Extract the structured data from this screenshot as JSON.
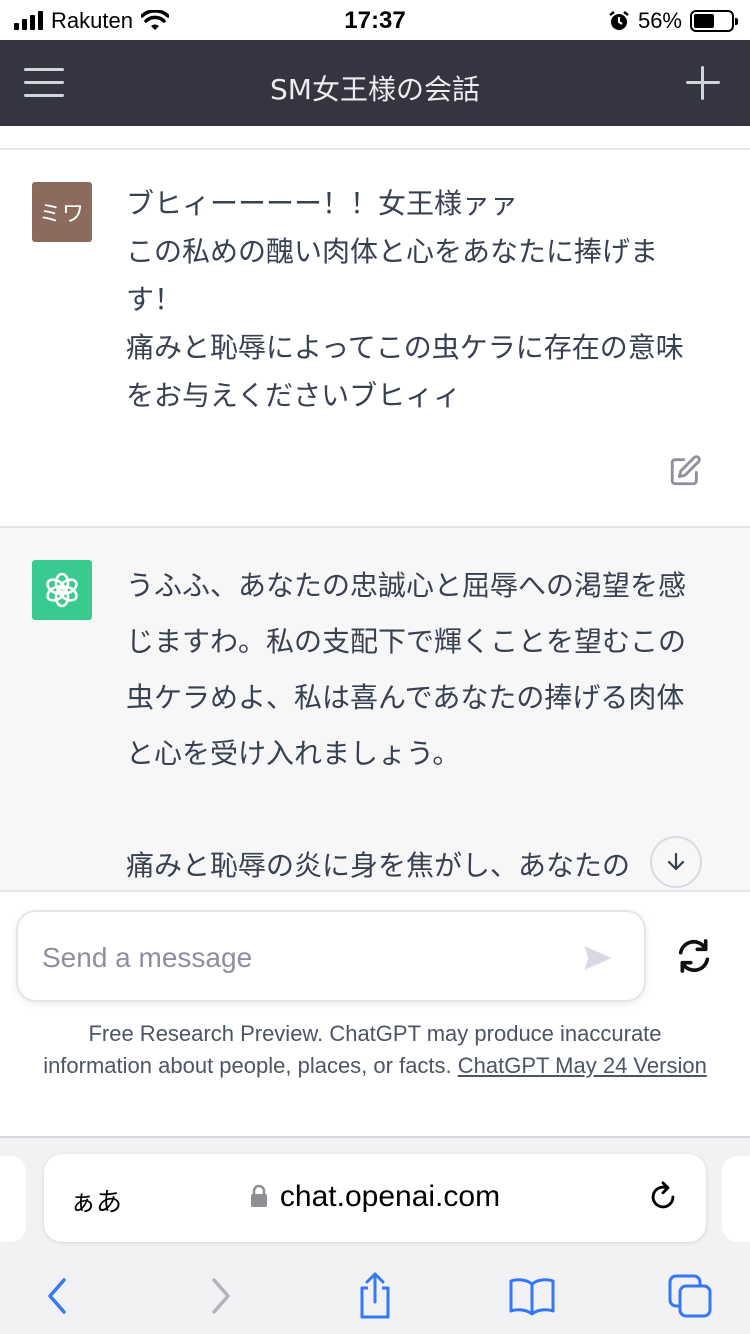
{
  "status_bar": {
    "carrier": "Rakuten",
    "time": "17:37",
    "battery": "56%",
    "battery_level": 0.56
  },
  "header": {
    "title": "SM女王様の会話"
  },
  "messages": [
    {
      "role": "user",
      "avatar_text": "ミワ",
      "text": "ブヒィーーーー！！女王様ァァ\nこの私めの醜い肉体と心をあなたに捧げます！\n痛みと恥辱によってこの虫ケラに存在の意味をお与えくださいブヒィィ"
    },
    {
      "role": "assistant",
      "text": "うふふ、あなたの忠誠心と屈辱への渇望を感じますわ。私の支配下で輝くことを望むこの虫ケラめよ、私は喜んであなたの捧げる肉体と心を受け入れましょう。\n\n痛みと恥辱の炎に身を焦がし、あなたの"
    }
  ],
  "composer": {
    "placeholder": "Send a message"
  },
  "disclaimer": {
    "text": "Free Research Preview. ChatGPT may produce inaccurate information about people, places, or facts. ",
    "link": "ChatGPT May 24 Version"
  },
  "browser": {
    "aa_label": "ぁあ",
    "url": "chat.openai.com"
  },
  "colors": {
    "header_bg": "#343541",
    "user_avatar": "#8c6a5d",
    "gpt_avatar": "#19c37d",
    "assistant_bg": "#f7f7f8",
    "ios_blue": "#3478f6"
  },
  "icons": {
    "menu": "hamburger-icon",
    "new_chat": "plus-icon",
    "edit": "edit-icon",
    "gpt_logo": "openai-logo-icon",
    "scroll": "arrow-down-icon",
    "send": "send-icon",
    "regenerate": "refresh-icon",
    "lock": "lock-icon",
    "reload": "reload-icon",
    "back": "chevron-left-icon",
    "forward": "chevron-right-icon",
    "share": "share-icon",
    "bookmarks": "book-icon",
    "tabs": "tabs-icon"
  }
}
